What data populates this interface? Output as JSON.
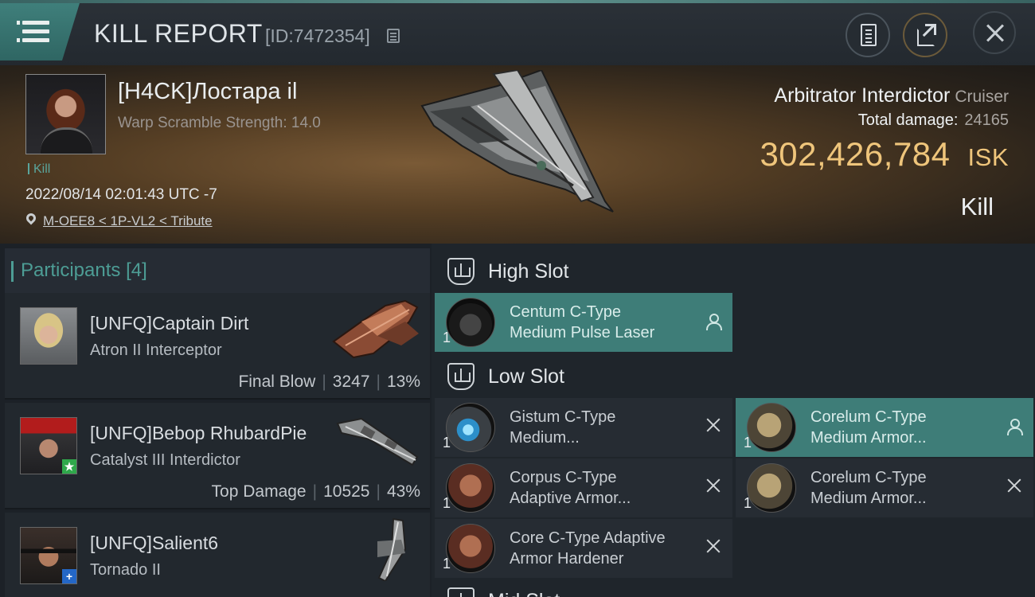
{
  "header": {
    "title": "KILL REPORT",
    "report_id": "[ID:7472354]"
  },
  "victim": {
    "name": "[H4CK]Лостара il",
    "stat": "Warp Scramble Strength: 14.0",
    "tag": "Kill",
    "timestamp": "2022/08/14 02:01:43 UTC -7",
    "location": "M-OEE8 < 1P-VL2 < Tribute",
    "ship_name": "Arbitrator Interdictor",
    "ship_class": "Cruiser",
    "total_damage_label": "Total damage:",
    "total_damage": "24165",
    "isk_value": "302,426,784",
    "isk_unit": "ISK",
    "result": "Kill"
  },
  "participants": {
    "title": "Participants",
    "count": "[4]",
    "rows": [
      {
        "name": "[UNFQ]Captain Dirt",
        "ship": "Atron II Interceptor",
        "role": "Final Blow",
        "damage": "3247",
        "percent": "13%"
      },
      {
        "name": "[UNFQ]Bebop RhubardPie",
        "ship": "Catalyst III Interdictor",
        "role": "Top Damage",
        "damage": "10525",
        "percent": "43%",
        "badge": "★"
      },
      {
        "name": "[UNFQ]Salient6",
        "ship": "Tornado II",
        "badge": "+"
      }
    ]
  },
  "slots": {
    "high": {
      "label": "High Slot",
      "modules": [
        {
          "qty": "1",
          "line1": "Centum C-Type",
          "line2": "Medium Pulse Laser"
        }
      ]
    },
    "low": {
      "label": "Low Slot",
      "modules": [
        {
          "qty": "1",
          "line1": "Gistum C-Type",
          "line2": "Medium..."
        },
        {
          "qty": "1",
          "line1": "Corelum C-Type",
          "line2": "Medium Armor..."
        },
        {
          "qty": "1",
          "line1": "Corpus C-Type",
          "line2": "Adaptive Armor..."
        },
        {
          "qty": "1",
          "line1": "Corelum C-Type",
          "line2": "Medium Armor..."
        },
        {
          "qty": "1",
          "line1": "Core C-Type Adaptive",
          "line2": "Armor Hardener"
        }
      ]
    },
    "mid": {
      "label": "Mid Slot"
    }
  }
}
